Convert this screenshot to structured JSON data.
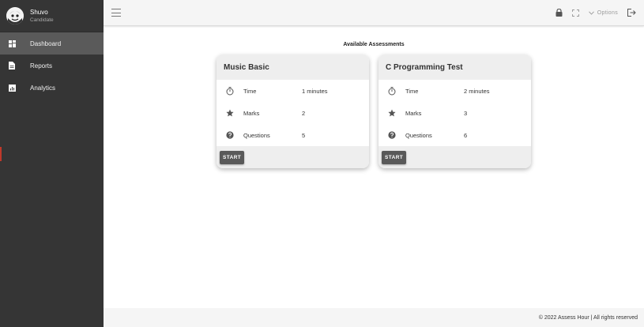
{
  "user": {
    "name": "Shuvo",
    "role": "Candidate"
  },
  "sidebar": {
    "items": [
      {
        "label": "Dashboard",
        "icon": "dashboard-icon",
        "active": true
      },
      {
        "label": "Reports",
        "icon": "document-icon",
        "active": false
      },
      {
        "label": "Analytics",
        "icon": "analytics-icon",
        "active": false
      }
    ]
  },
  "topbar": {
    "options_label": "Options",
    "icons": [
      "lock-icon",
      "fullscreen-icon",
      "chevron-down-icon",
      "logout-icon"
    ]
  },
  "main": {
    "title": "Available Assessments",
    "cards": [
      {
        "title": "Music Basic",
        "rows": [
          {
            "icon": "timer-icon",
            "label": "Time",
            "value": "1 minutes"
          },
          {
            "icon": "star-icon",
            "label": "Marks",
            "value": "2"
          },
          {
            "icon": "question-icon",
            "label": "Questions",
            "value": "5"
          }
        ],
        "button": "START"
      },
      {
        "title": "C Programming Test",
        "rows": [
          {
            "icon": "timer-icon",
            "label": "Time",
            "value": "2 minutes"
          },
          {
            "icon": "star-icon",
            "label": "Marks",
            "value": "3"
          },
          {
            "icon": "question-icon",
            "label": "Questions",
            "value": "6"
          }
        ],
        "button": "START"
      }
    ]
  },
  "footer": {
    "text": "© 2022 Assess Hour | All rights reserved"
  },
  "colors": {
    "sidebar": "#353535",
    "sidebar_active": "#5a5a5a",
    "button": "#595959",
    "accent": "#c0392b"
  }
}
